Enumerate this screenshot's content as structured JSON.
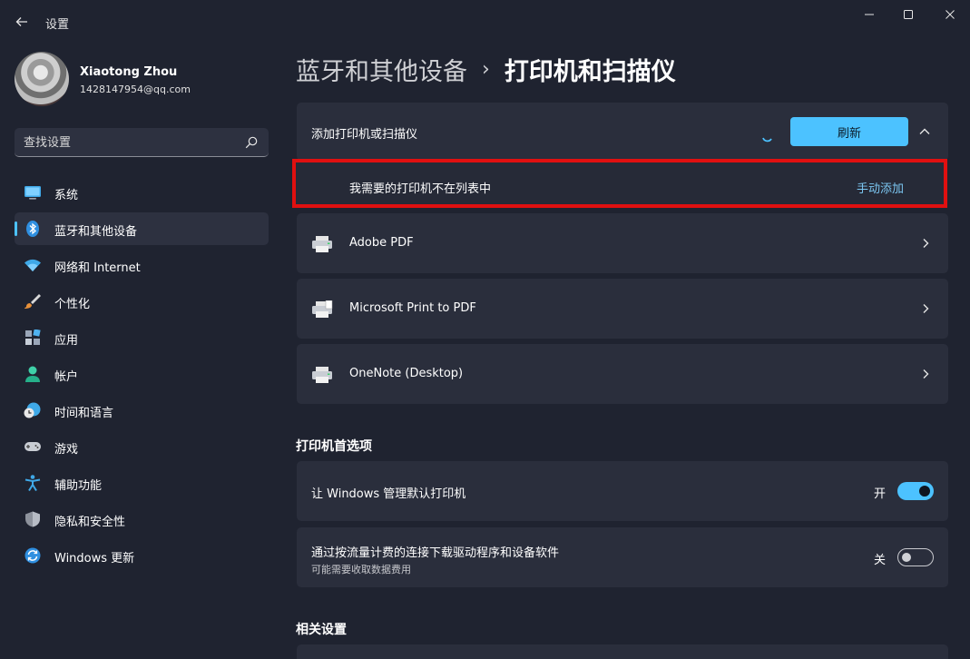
{
  "window": {
    "title": "设置",
    "controls": [
      "minimize",
      "maximize",
      "close"
    ]
  },
  "profile": {
    "name": "Xiaotong Zhou",
    "email": "1428147954@qq.com"
  },
  "search": {
    "placeholder": "查找设置"
  },
  "sidebar": {
    "items": [
      {
        "label": "系统",
        "icon": "monitor-icon",
        "active": false
      },
      {
        "label": "蓝牙和其他设备",
        "icon": "bluetooth-icon",
        "active": true
      },
      {
        "label": "网络和 Internet",
        "icon": "wifi-icon",
        "active": false
      },
      {
        "label": "个性化",
        "icon": "brush-icon",
        "active": false
      },
      {
        "label": "应用",
        "icon": "apps-icon",
        "active": false
      },
      {
        "label": "帐户",
        "icon": "person-icon",
        "active": false
      },
      {
        "label": "时间和语言",
        "icon": "globe-clock-icon",
        "active": false
      },
      {
        "label": "游戏",
        "icon": "gamepad-icon",
        "active": false
      },
      {
        "label": "辅助功能",
        "icon": "accessibility-icon",
        "active": false
      },
      {
        "label": "隐私和安全性",
        "icon": "shield-icon",
        "active": false
      },
      {
        "label": "Windows 更新",
        "icon": "update-icon",
        "active": false
      }
    ]
  },
  "breadcrumb": {
    "parent": "蓝牙和其他设备",
    "separator": "›",
    "current": "打印机和扫描仪"
  },
  "add_printer": {
    "title": "添加打印机或扫描仪",
    "refresh_label": "刷新",
    "manual_text": "我需要的打印机不在列表中",
    "manual_link": "手动添加"
  },
  "printers": [
    {
      "name": "Adobe PDF"
    },
    {
      "name": "Microsoft Print to PDF"
    },
    {
      "name": "OneNote (Desktop)"
    }
  ],
  "preferences": {
    "title": "打印机首选项",
    "items": [
      {
        "label": "让 Windows 管理默认打印机",
        "sublabel": "",
        "state_label": "开",
        "on": true
      },
      {
        "label": "通过按流量计费的连接下载驱动程序和设备软件",
        "sublabel": "可能需要收取数据费用",
        "state_label": "关",
        "on": false
      }
    ]
  },
  "related": {
    "title": "相关设置"
  },
  "colors": {
    "accent": "#4cc2ff",
    "background": "#1f2330",
    "card": "#2a2e3c",
    "highlight_border": "#e01010"
  }
}
